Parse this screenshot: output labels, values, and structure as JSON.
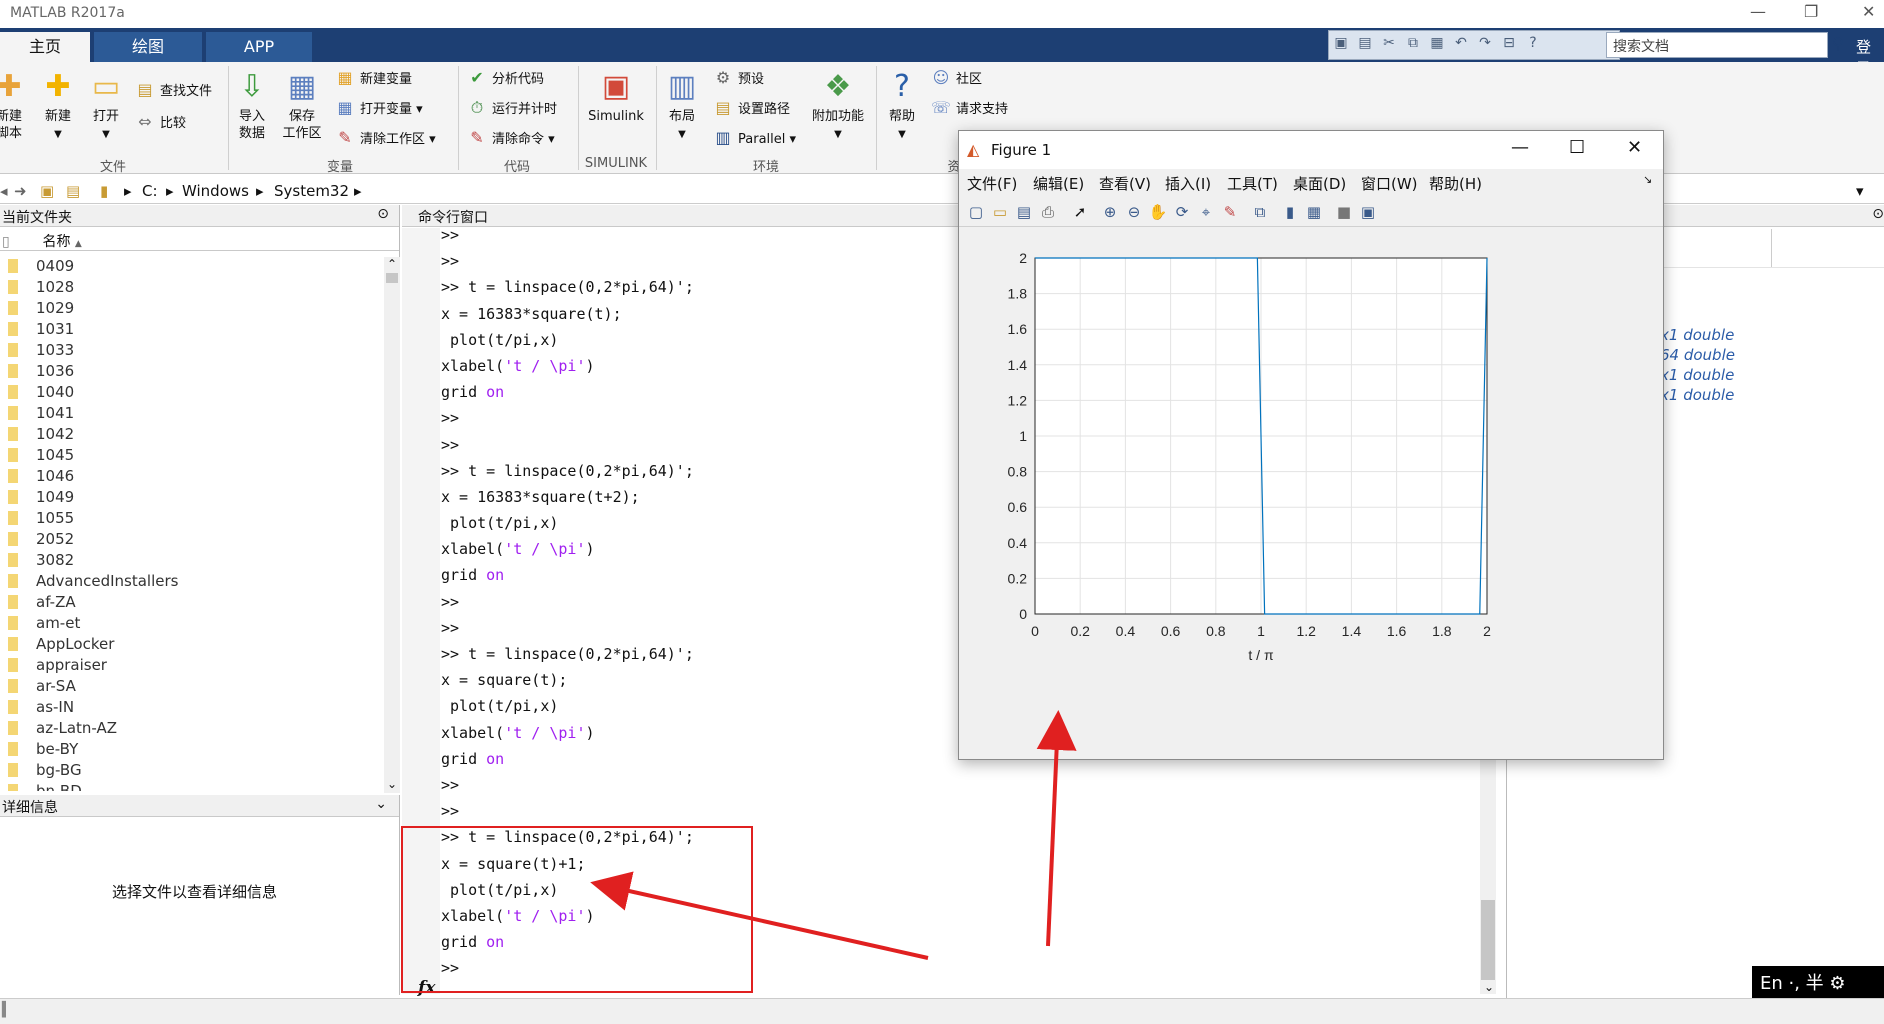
{
  "app": {
    "title": "MATLAB R2017a"
  },
  "tabs": [
    {
      "label": "主页",
      "active": true
    },
    {
      "label": "绘图",
      "active": false
    },
    {
      "label": "APP",
      "active": false
    }
  ],
  "search": {
    "placeholder": "搜索文档"
  },
  "login_label": "登录",
  "ribbon": {
    "new_script": "新建\n脚本",
    "new": "新建",
    "open": "打开",
    "find_files": "查找文件",
    "compare": "比较",
    "import_data": "导入\n数据",
    "save_workspace": "保存\n工作区",
    "new_variable": "新建变量",
    "open_variable": "打开变量",
    "clear_workspace": "清除工作区",
    "analyze_code": "分析代码",
    "run_and_time": "运行并计时",
    "clear_commands": "清除命令",
    "simulink": "Simulink",
    "layout": "布局",
    "preferences": "预设",
    "set_path": "设置路径",
    "parallel": "Parallel",
    "addons": "附加功能",
    "help": "帮助",
    "community": "社区",
    "request_support": "请求支持",
    "groups": [
      "文件",
      "变量",
      "代码",
      "SIMULINK",
      "环境",
      "资"
    ]
  },
  "path": [
    "C:",
    "Windows",
    "System32"
  ],
  "folder_panel": {
    "title": "当前文件夹",
    "column_name": "名称",
    "items": [
      "0409",
      "1028",
      "1029",
      "1031",
      "1033",
      "1036",
      "1040",
      "1041",
      "1042",
      "1045",
      "1046",
      "1049",
      "1055",
      "2052",
      "3082",
      "AdvancedInstallers",
      "af-ZA",
      "am-et",
      "AppLocker",
      "appraiser",
      "ar-SA",
      "as-IN",
      "az-Latn-AZ",
      "be-BY",
      "bg-BG",
      "bn-BD"
    ]
  },
  "detail_panel": {
    "title": "详细信息",
    "message": "选择文件以查看详细信息"
  },
  "command_window": {
    "title": "命令行窗口",
    "lines": [
      ">>",
      ">>",
      ">> t = linspace(0,2*pi,64)';",
      "x = 16383*square(t);",
      " plot(t/pi,x)",
      "xlabel('t / \\pi')",
      "grid on",
      ">>",
      ">>",
      ">> t = linspace(0,2*pi,64)';",
      "x = 16383*square(t+2);",
      " plot(t/pi,x)",
      "xlabel('t / \\pi')",
      "grid on",
      ">>",
      ">>",
      ">> t = linspace(0,2*pi,64)';",
      "x = square(t);",
      " plot(t/pi,x)",
      "xlabel('t / \\pi')",
      "grid on",
      ">>",
      ">>",
      ">> t = linspace(0,2*pi,64)';",
      "x = square(t)+1;",
      " plot(t/pi,x)",
      "xlabel('t / \\pi')",
      "grid on",
      ">>"
    ],
    "prompt_icon": "fx"
  },
  "workspace": {
    "items": [
      "x1 double",
      "64 double",
      "x1 double",
      "x1 double"
    ]
  },
  "figure": {
    "title": "Figure 1",
    "menus": [
      "文件(F)",
      "编辑(E)",
      "查看(V)",
      "插入(I)",
      "工具(T)",
      "桌面(D)",
      "窗口(W)",
      "帮助(H)"
    ]
  },
  "ime": {
    "text": "En ·, 半 ⚙"
  },
  "chart_data": {
    "type": "line",
    "xlabel": "t / π",
    "ylabel": "",
    "title": "",
    "xlim": [
      0,
      2
    ],
    "ylim": [
      0,
      2
    ],
    "xticks": [
      "0",
      "0.2",
      "0.4",
      "0.6",
      "0.8",
      "1",
      "1.2",
      "1.4",
      "1.6",
      "1.8",
      "2"
    ],
    "yticks": [
      "0",
      "0.2",
      "0.4",
      "0.6",
      "0.8",
      "1",
      "1.2",
      "1.4",
      "1.6",
      "1.8",
      "2"
    ],
    "grid": true,
    "series": [
      {
        "color": "#0072bd",
        "x": [
          0,
          0.984,
          1.016,
          1.968,
          2.0
        ],
        "y": [
          2,
          2,
          0,
          0,
          2
        ]
      }
    ]
  },
  "colors": {
    "tab_bar": "#1d3f73",
    "annotation": "#e02020",
    "string_purple": "#a020f0"
  }
}
